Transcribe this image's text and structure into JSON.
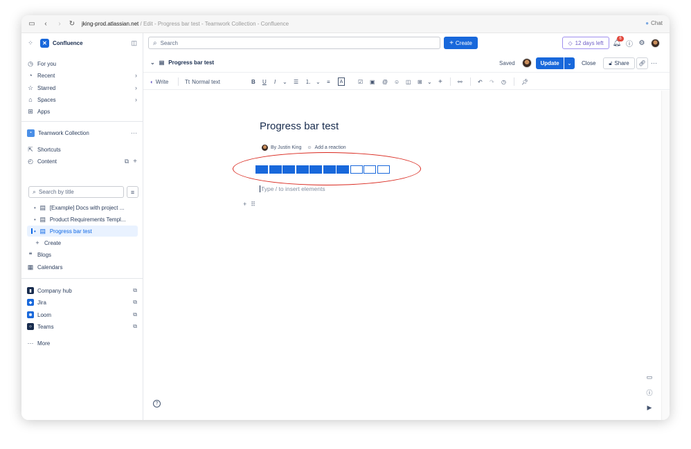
{
  "browser": {
    "url_domain": "jking-prod.atlassian.net",
    "url_rest": " / Edit - Progress bar test - Teamwork Collection - Confluence",
    "chat_label": "Chat"
  },
  "sidebar": {
    "app_name": "Confluence",
    "nav": [
      {
        "label": "For you",
        "icon": "clock-icon"
      },
      {
        "label": "Recent",
        "icon": "history-icon"
      },
      {
        "label": "Starred",
        "icon": "star-icon"
      },
      {
        "label": "Spaces",
        "icon": "spaces-icon"
      },
      {
        "label": "Apps",
        "icon": "apps-icon"
      }
    ],
    "space_name": "Teamwork Collection",
    "space_more": "···",
    "shortcuts_label": "Shortcuts",
    "content_label": "Content",
    "search_placeholder": "Search by title",
    "tree": [
      {
        "label": "[Example] Docs with project ..."
      },
      {
        "label": "Product Requirements Templ..."
      },
      {
        "label": "Progress bar test"
      }
    ],
    "create_label": "Create",
    "blogs_label": "Blogs",
    "calendars_label": "Calendars",
    "apps": [
      {
        "label": "Company hub",
        "color": "#172b4d"
      },
      {
        "label": "Jira",
        "color": "#1868db"
      },
      {
        "label": "Loom",
        "color": "#1868db"
      },
      {
        "label": "Teams",
        "color": "#172b4d"
      }
    ],
    "more_label": "More"
  },
  "topnav": {
    "search_placeholder": "Search",
    "create_label": "Create",
    "trial_label": "12 days left",
    "notification_count": "6"
  },
  "editor_header": {
    "title": "Progress bar test",
    "saved_label": "Saved",
    "update_label": "Update",
    "close_label": "Close",
    "share_label": "Share"
  },
  "toolbar": {
    "write_label": "Write",
    "text_style_label": "Normal text"
  },
  "page": {
    "title": "Progress bar test",
    "author": "By Justin King",
    "reaction_label": "Add a reaction",
    "placeholder": "Type / to insert elements",
    "progress": {
      "filled": 7,
      "total": 10
    },
    "accent": "#1868db",
    "highlight_color": "#d9261c"
  }
}
